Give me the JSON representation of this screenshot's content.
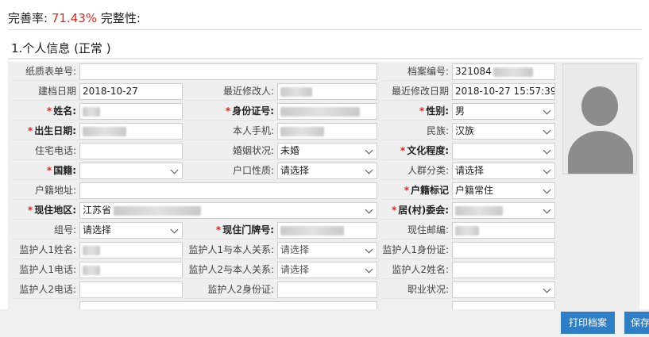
{
  "header": {
    "completion_label": "完善率:",
    "completion_value": "71.43%",
    "integrity_label": "完整性:"
  },
  "section": {
    "title": "1.个人信息 (正常 )"
  },
  "form": {
    "paper_form_no": {
      "label": "纸质表单号:"
    },
    "archive_no": {
      "label": "档案编号:",
      "value": "321084"
    },
    "created_date": {
      "label": "建档日期",
      "value": "2018-10-27"
    },
    "last_modifier": {
      "label": "最近修改人:"
    },
    "last_modified_date": {
      "label": "最近修改日期",
      "value": "2018-10-27 15:57:39"
    },
    "name": {
      "label": "姓名:"
    },
    "id_number": {
      "label": "身份证号:"
    },
    "gender": {
      "label": "性别:",
      "value": "男"
    },
    "birth_date": {
      "label": "出生日期:"
    },
    "phone": {
      "label": "本人手机:"
    },
    "ethnicity": {
      "label": "民族:",
      "value": "汉族"
    },
    "home_phone": {
      "label": "住宅电话:"
    },
    "marital": {
      "label": "婚姻状况:",
      "value": "未婚"
    },
    "education": {
      "label": "文化程度:"
    },
    "nationality": {
      "label": "国籍:"
    },
    "hukou_type": {
      "label": "户口性质:",
      "value": "请选择"
    },
    "population": {
      "label": "人群分类:",
      "value": "请选择"
    },
    "hukou_addr": {
      "label": "户籍地址:"
    },
    "hukou_flag": {
      "label": "户籍标记",
      "value": "户籍常住"
    },
    "current_area": {
      "label": "现住地区:",
      "value": "江苏省"
    },
    "committee": {
      "label": "居(村)委会:"
    },
    "group_no": {
      "label": "组号:",
      "value": "请选择"
    },
    "house_no": {
      "label": "现住门牌号:"
    },
    "postcode": {
      "label": "现住邮编:"
    },
    "guardian1_name": {
      "label": "监护人1姓名:"
    },
    "guardian1_rel": {
      "label": "监护人1与本人关系:",
      "value": "请选择"
    },
    "guardian1_id": {
      "label": "监护人1身份证:"
    },
    "guardian1_phone": {
      "label": "监护人1电话:"
    },
    "guardian2_rel": {
      "label": "监护人2与本人关系:",
      "value": "请选择"
    },
    "guardian2_name": {
      "label": "监护人2姓名:"
    },
    "guardian2_phone": {
      "label": "监护人2电话:"
    },
    "guardian2_id": {
      "label": "监护人2身份证:"
    },
    "occupation": {
      "label": "职业状况:"
    }
  },
  "buttons": {
    "print": "打印档案",
    "save": "保存"
  }
}
